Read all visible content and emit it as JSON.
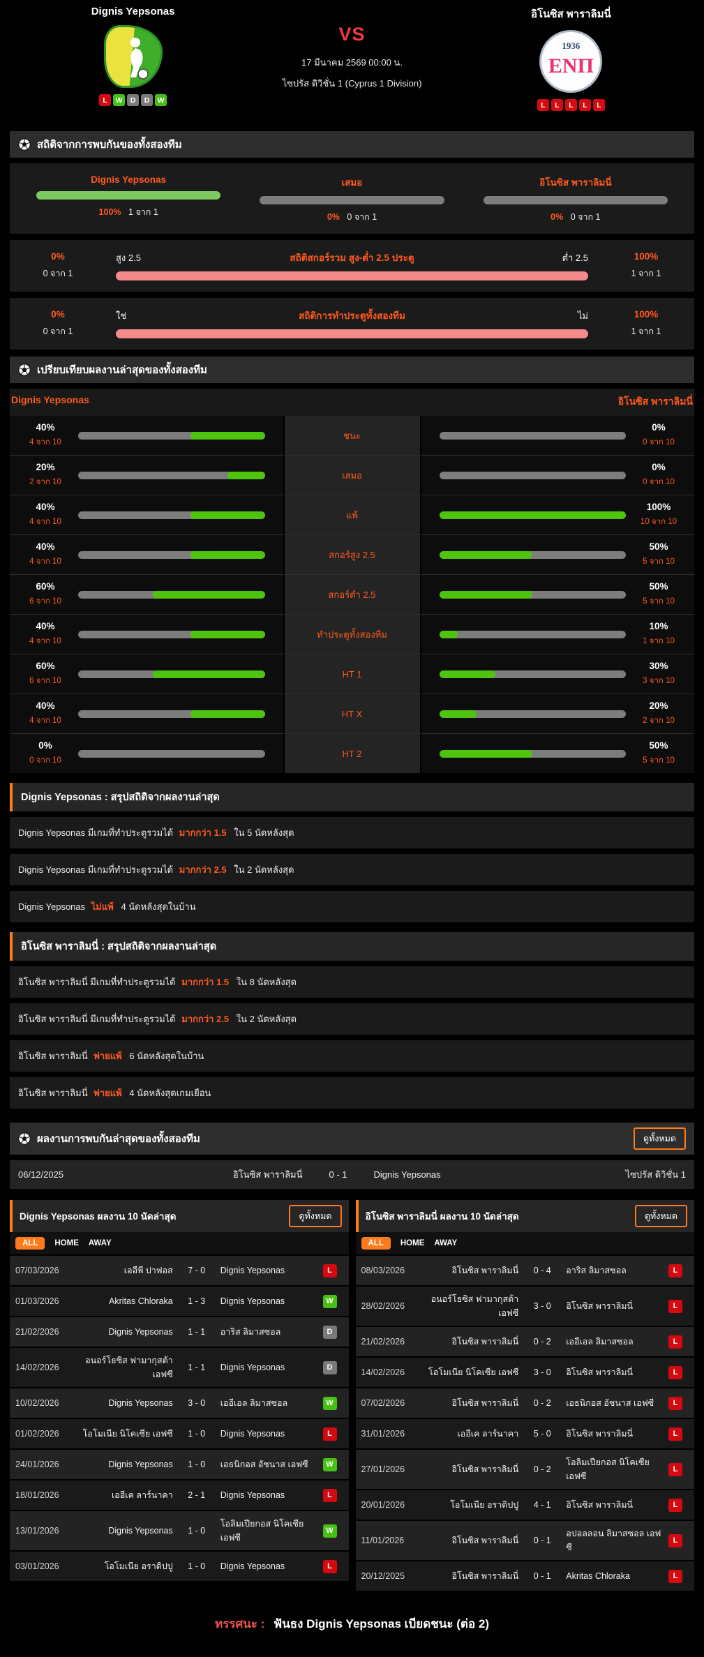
{
  "colors": {
    "accent_orange": "#ff5a1f",
    "button_orange": "#ff7a1a",
    "bar_green": "#4ec40e",
    "bar_green_light": "#7cc95f",
    "bar_gray": "#7d7d7d",
    "bar_salmon": "#f38b8b",
    "win_badge": "#46c113",
    "lose_badge": "#d40a10",
    "draw_badge": "#7a7a7a",
    "vs_red": "#ef3b3b"
  },
  "header": {
    "home": {
      "name": "Dignis Yepsonas",
      "form": [
        "L",
        "W",
        "D",
        "D",
        "W"
      ]
    },
    "away": {
      "name": "อิโนซิส พาราลิมนี่",
      "form": [
        "L",
        "L",
        "L",
        "L",
        "L"
      ],
      "logo_year": "1936",
      "logo_monogram": "ΕΝΠ"
    },
    "vs": "VS",
    "datetime": "17 มีนาคม 2569 00:00 น.",
    "league": "ไซปรัส ดิวิชั่น 1 (Cyprus 1 Division)"
  },
  "h2h": {
    "title": "สถิติจากการพบกันของทั้งสองทีม",
    "outcome": [
      {
        "label": "Dignis Yepsonas",
        "pct": 100,
        "pct_text": "100%",
        "count": "1 จาก 1"
      },
      {
        "label": "เสมอ",
        "pct": 0,
        "pct_text": "0%",
        "count": "0 จาก 1"
      },
      {
        "label": "อิโนซิส พาราลิมนี่",
        "pct": 0,
        "pct_text": "0%",
        "count": "0 จาก 1"
      }
    ],
    "over_under": {
      "title": "สถิติสกอร์รวม สูง-ต่ำ 2.5 ประตู",
      "left_label": "สูง 2.5",
      "right_label": "ต่ำ 2.5",
      "left_pct": "0%",
      "left_count": "0 จาก 1",
      "right_pct": "100%",
      "right_count": "1 จาก 1"
    },
    "btts": {
      "title": "สถิติการทำประตูทั้งสองทีม",
      "left_label": "ใช่",
      "right_label": "ไม่",
      "left_pct": "0%",
      "left_count": "0 จาก 1",
      "right_pct": "100%",
      "right_count": "1 จาก 1"
    }
  },
  "comparison": {
    "title": "เปรียบเทียบผลงานล่าสุดของทั้งสองทีม",
    "home_team": "Dignis Yepsonas",
    "away_team": "อิโนซิส พาราลิมนี่",
    "rows": [
      {
        "label": "ชนะ",
        "home_pct": 40,
        "home_pct_text": "40%",
        "home_count": "4 จาก 10",
        "away_pct": 0,
        "away_pct_text": "0%",
        "away_count": "0 จาก 10"
      },
      {
        "label": "เสมอ",
        "home_pct": 20,
        "home_pct_text": "20%",
        "home_count": "2 จาก 10",
        "away_pct": 0,
        "away_pct_text": "0%",
        "away_count": "0 จาก 10"
      },
      {
        "label": "แพ้",
        "home_pct": 40,
        "home_pct_text": "40%",
        "home_count": "4 จาก 10",
        "away_pct": 100,
        "away_pct_text": "100%",
        "away_count": "10 จาก 10"
      },
      {
        "label": "สกอร์สูง 2.5",
        "home_pct": 40,
        "home_pct_text": "40%",
        "home_count": "4 จาก 10",
        "away_pct": 50,
        "away_pct_text": "50%",
        "away_count": "5 จาก 10"
      },
      {
        "label": "สกอร์ต่ำ 2.5",
        "home_pct": 60,
        "home_pct_text": "60%",
        "home_count": "6 จาก 10",
        "away_pct": 50,
        "away_pct_text": "50%",
        "away_count": "5 จาก 10"
      },
      {
        "label": "ทำประตูทั้งสองทีม",
        "home_pct": 40,
        "home_pct_text": "40%",
        "home_count": "4 จาก 10",
        "away_pct": 10,
        "away_pct_text": "10%",
        "away_count": "1 จาก 10"
      },
      {
        "label": "HT 1",
        "home_pct": 60,
        "home_pct_text": "60%",
        "home_count": "6 จาก 10",
        "away_pct": 30,
        "away_pct_text": "30%",
        "away_count": "3 จาก 10"
      },
      {
        "label": "HT X",
        "home_pct": 40,
        "home_pct_text": "40%",
        "home_count": "4 จาก 10",
        "away_pct": 20,
        "away_pct_text": "20%",
        "away_count": "2 จาก 10"
      },
      {
        "label": "HT 2",
        "home_pct": 0,
        "home_pct_text": "0%",
        "home_count": "0 จาก 10",
        "away_pct": 50,
        "away_pct_text": "50%",
        "away_count": "5 จาก 10"
      }
    ]
  },
  "summaries": [
    {
      "title": "Dignis Yepsonas : สรุปสถิติจากผลงานล่าสุด",
      "items": [
        {
          "pre": "Dignis Yepsonas  มีเกมที่ทำประตูรวมได้",
          "highlight": "มากกว่า  1.5",
          "post": "ใน 5 นัดหลังสุด"
        },
        {
          "pre": "Dignis Yepsonas  มีเกมที่ทำประตูรวมได้",
          "highlight": "มากกว่า  2.5",
          "post": "ใน 2 นัดหลังสุด"
        },
        {
          "pre": "Dignis Yepsonas",
          "highlight": "ไม่แพ้",
          "post": "4  นัดหลังสุดในบ้าน"
        }
      ]
    },
    {
      "title": "อิโนซิส พาราลิมนี่ : สรุปสถิติจากผลงานล่าสุด",
      "items": [
        {
          "pre": "อิโนซิส พาราลิมนี่  มีเกมที่ทำประตูรวมได้",
          "highlight": "มากกว่า  1.5",
          "post": "ใน 8 นัดหลังสุด"
        },
        {
          "pre": "อิโนซิส พาราลิมนี่  มีเกมที่ทำประตูรวมได้",
          "highlight": "มากกว่า  2.5",
          "post": "ใน 2 นัดหลังสุด"
        },
        {
          "pre": "อิโนซิส พาราลิมนี่",
          "highlight": "พ่ายแพ้",
          "post": "6  นัดหลังสุดในบ้าน"
        },
        {
          "pre": "อิโนซิส พาราลิมนี่",
          "highlight": "พ่ายแพ้",
          "post": "4  นัดหลังสุดเกมเยือน"
        }
      ]
    }
  ],
  "h2h_recent": {
    "title": "ผลงานการพบกันล่าสุดของทั้งสองทีม",
    "view_all": "ดูทั้งหมด",
    "matches": [
      {
        "date": "06/12/2025",
        "home": "อิโนซิส พาราลิมนี่",
        "score": "0 - 1",
        "away": "Dignis Yepsonas",
        "league": "ไซปรัส ดิวิชั่น 1"
      }
    ]
  },
  "tables": [
    {
      "title": "Dignis Yepsonas ผลงาน 10 นัดล่าสุด",
      "view_all": "ดูทั้งหมด",
      "tabs": [
        "ALL",
        "HOME",
        "AWAY"
      ],
      "active_tab": "ALL",
      "rows": [
        {
          "date": "07/03/2026",
          "home": "เออีพี ปาฟอส",
          "score": "7 - 0",
          "away": "Dignis Yepsonas",
          "result": "L"
        },
        {
          "date": "01/03/2026",
          "home": "Akritas Chloraka",
          "score": "1 - 3",
          "away": "Dignis Yepsonas",
          "result": "W"
        },
        {
          "date": "21/02/2026",
          "home": "Dignis Yepsonas",
          "score": "1 - 1",
          "away": "อาริส ลิมาสซอล",
          "result": "D"
        },
        {
          "date": "14/02/2026",
          "home": "อนอร์โธซิส ฟามากุสต้า เอฟซี",
          "score": "1 - 1",
          "away": "Dignis Yepsonas",
          "result": "D"
        },
        {
          "date": "10/02/2026",
          "home": "Dignis Yepsonas",
          "score": "3 - 0",
          "away": "เออีเอล ลิมาสซอล",
          "result": "W"
        },
        {
          "date": "01/02/2026",
          "home": "โอโมเนีย นิโคเซีย เอฟซี",
          "score": "1 - 0",
          "away": "Dignis Yepsonas",
          "result": "L"
        },
        {
          "date": "24/01/2026",
          "home": "Dignis Yepsonas",
          "score": "1 - 0",
          "away": "เอธนิกอส อัชนาส เอฟซี",
          "result": "W"
        },
        {
          "date": "18/01/2026",
          "home": "เออีเค ลาร์นาคา",
          "score": "2 - 1",
          "away": "Dignis Yepsonas",
          "result": "L"
        },
        {
          "date": "13/01/2026",
          "home": "Dignis Yepsonas",
          "score": "1 - 0",
          "away": "โอลิมเปียกอส นิโคเซีย เอฟซี",
          "result": "W"
        },
        {
          "date": "03/01/2026",
          "home": "โอโมเนีย อราดิปปู",
          "score": "1 - 0",
          "away": "Dignis Yepsonas",
          "result": "L"
        }
      ]
    },
    {
      "title": "อิโนซิส พาราลิมนี่ ผลงาน 10 นัดล่าสุด",
      "view_all": "ดูทั้งหมด",
      "tabs": [
        "ALL",
        "HOME",
        "AWAY"
      ],
      "active_tab": "ALL",
      "rows": [
        {
          "date": "08/03/2026",
          "home": "อิโนซิส พาราลิมนี่",
          "score": "0 - 4",
          "away": "อาริส ลิมาสซอล",
          "result": "L"
        },
        {
          "date": "28/02/2026",
          "home": "อนอร์โธซิส ฟามากุสต้า เอฟซี",
          "score": "3 - 0",
          "away": "อิโนซิส พาราลิมนี่",
          "result": "L"
        },
        {
          "date": "21/02/2026",
          "home": "อิโนซิส พาราลิมนี่",
          "score": "0 - 2",
          "away": "เออีเอล ลิมาสซอล",
          "result": "L"
        },
        {
          "date": "14/02/2026",
          "home": "โอโมเนีย นิโคเซีย เอฟซี",
          "score": "3 - 0",
          "away": "อิโนซิส พาราลิมนี่",
          "result": "L"
        },
        {
          "date": "07/02/2026",
          "home": "อิโนซิส พาราลิมนี่",
          "score": "0 - 2",
          "away": "เอธนิกอส อัชนาส เอฟซี",
          "result": "L"
        },
        {
          "date": "31/01/2026",
          "home": "เออีเค ลาร์นาคา",
          "score": "5 - 0",
          "away": "อิโนซิส พาราลิมนี่",
          "result": "L"
        },
        {
          "date": "27/01/2026",
          "home": "อิโนซิส พาราลิมนี่",
          "score": "0 - 2",
          "away": "โอลิมเปียกอส นิโคเซีย เอฟซี",
          "result": "L"
        },
        {
          "date": "20/01/2026",
          "home": "โอโมเนีย อราดิปปู",
          "score": "4 - 1",
          "away": "อิโนซิส พาราลิมนี่",
          "result": "L"
        },
        {
          "date": "11/01/2026",
          "home": "อิโนซิส พาราลิมนี่",
          "score": "0 - 1",
          "away": "อปอลลอน ลิมาสซอล เอฟซี",
          "result": "L"
        },
        {
          "date": "20/12/2025",
          "home": "อิโนซิส พาราลิมนี่",
          "score": "0 - 1",
          "away": "Akritas Chloraka",
          "result": "L"
        }
      ]
    }
  ],
  "footer": {
    "label": "ทรรศนะ :",
    "text": "ฟันธง Dignis Yepsonas เบียดชนะ (ต่อ 2)"
  }
}
